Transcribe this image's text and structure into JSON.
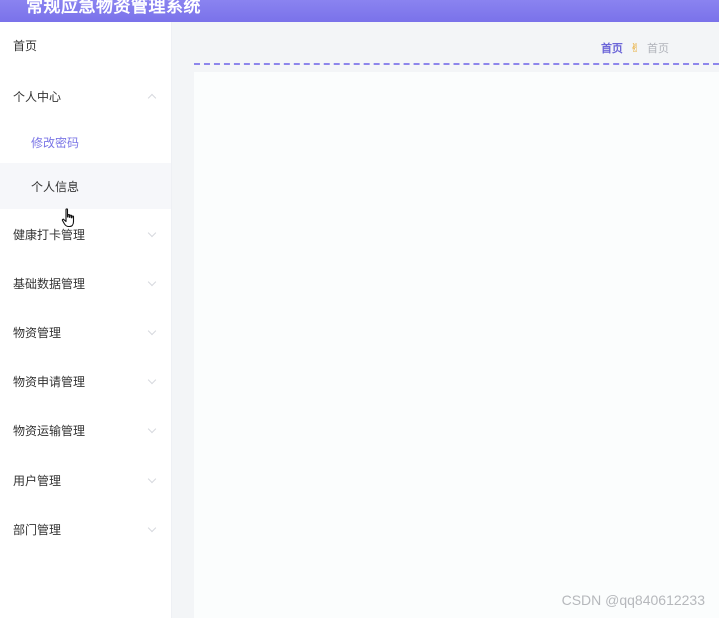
{
  "app": {
    "title": "常规应急物资管理系统"
  },
  "sidebar": {
    "items": [
      {
        "label": "首页",
        "type": "item"
      },
      {
        "label": "个人中心",
        "type": "group",
        "expanded": true
      },
      {
        "label": "修改密码",
        "type": "sub",
        "state": "active"
      },
      {
        "label": "个人信息",
        "type": "sub",
        "state": "hover"
      },
      {
        "label": "健康打卡管理",
        "type": "group",
        "expanded": false
      },
      {
        "label": "基础数据管理",
        "type": "group",
        "expanded": false
      },
      {
        "label": "物资管理",
        "type": "group",
        "expanded": false
      },
      {
        "label": "物资申请管理",
        "type": "group",
        "expanded": false
      },
      {
        "label": "物资运输管理",
        "type": "group",
        "expanded": false
      },
      {
        "label": "用户管理",
        "type": "group",
        "expanded": false
      },
      {
        "label": "部门管理",
        "type": "group",
        "expanded": false
      }
    ]
  },
  "breadcrumb": {
    "home": "首页",
    "separator": "✌",
    "current": "首页"
  },
  "watermark": "CSDN @qq840612233",
  "colors": {
    "accent": "#7b76e6",
    "header": "#7a72ea",
    "separator": "#e7a21a"
  },
  "icons": {
    "separator": "victory-hand-icon",
    "expand": "chevron-icon",
    "cursor": "hand-pointer-icon"
  }
}
